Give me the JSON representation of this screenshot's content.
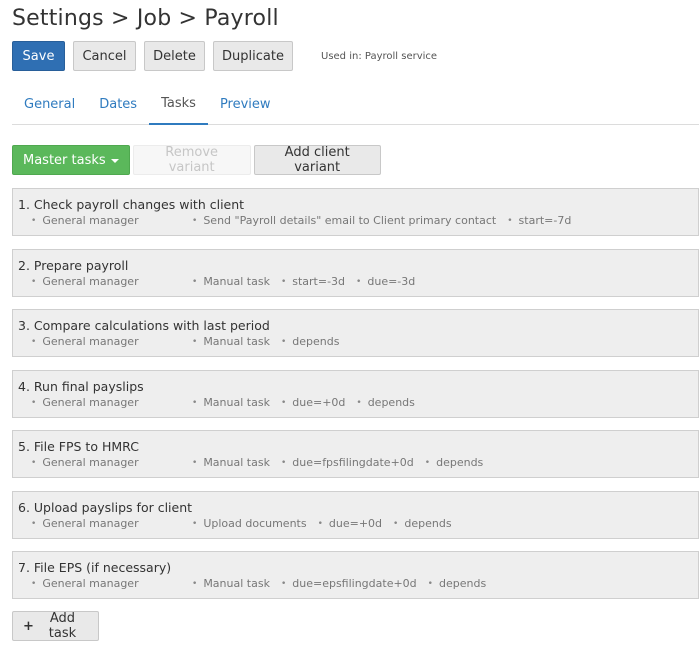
{
  "header": {
    "title": "Settings > Job > Payroll"
  },
  "toolbar": {
    "save_label": "Save",
    "cancel_label": "Cancel",
    "delete_label": "Delete",
    "duplicate_label": "Duplicate",
    "used_in": "Used in: Payroll service"
  },
  "tabs": [
    {
      "label": "General",
      "active": false
    },
    {
      "label": "Dates",
      "active": false
    },
    {
      "label": "Tasks",
      "active": true
    },
    {
      "label": "Preview",
      "active": false
    }
  ],
  "variants": {
    "master_label": "Master tasks",
    "remove_label": "Remove variant",
    "add_client_label": "Add client variant"
  },
  "tasks": [
    {
      "title": "1. Check payroll changes with client",
      "owner": "General manager",
      "details": [
        "Send \"Payroll details\" email to Client primary contact",
        "start=-7d"
      ]
    },
    {
      "title": "2. Prepare payroll",
      "owner": "General manager",
      "details": [
        "Manual task",
        "start=-3d",
        "due=-3d"
      ]
    },
    {
      "title": "3. Compare calculations with last period",
      "owner": "General manager",
      "details": [
        "Manual task",
        "depends"
      ]
    },
    {
      "title": "4. Run final payslips",
      "owner": "General manager",
      "details": [
        "Manual task",
        "due=+0d",
        "depends"
      ]
    },
    {
      "title": "5. File FPS to HMRC",
      "owner": "General manager",
      "details": [
        "Manual task",
        "due=fpsfilingdate+0d",
        "depends"
      ]
    },
    {
      "title": "6. Upload payslips for client",
      "owner": "General manager",
      "details": [
        "Upload documents",
        "due=+0d",
        "depends"
      ]
    },
    {
      "title": "7. File EPS (if necessary)",
      "owner": "General manager",
      "details": [
        "Manual task",
        "due=epsfilingdate+0d",
        "depends"
      ]
    }
  ],
  "footer": {
    "add_task_label": "Add task"
  },
  "colors": {
    "primary": "#2f6fb3",
    "success": "#5bb85b",
    "link": "#2f7bbf"
  }
}
